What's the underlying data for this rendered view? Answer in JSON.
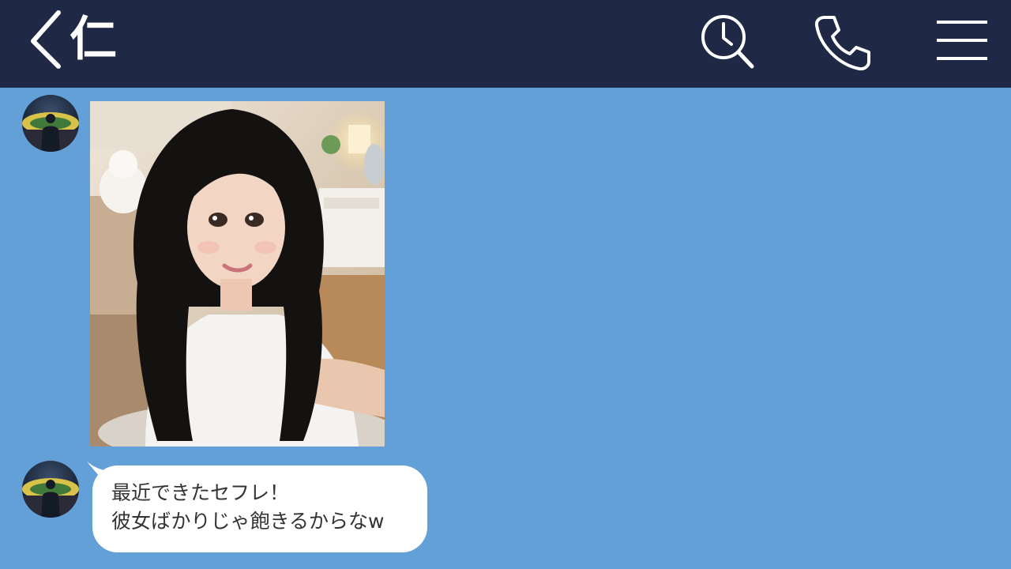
{
  "header": {
    "contact_name": "仁",
    "back_icon": "chevron-left-icon",
    "search_icon": "clock-search-icon",
    "call_icon": "phone-icon",
    "menu_icon": "hamburger-menu-icon"
  },
  "colors": {
    "header_bg": "#1f2945",
    "chat_bg": "#63a0d8",
    "bubble_bg": "#ffffff",
    "text": "#333333"
  },
  "messages": [
    {
      "type": "image",
      "sender": "仁",
      "content": "selfie-photo"
    },
    {
      "type": "text",
      "sender": "仁",
      "lines": [
        "最近できたセフレ！",
        "彼女ばかりじゃ飽きるからなw"
      ]
    }
  ]
}
